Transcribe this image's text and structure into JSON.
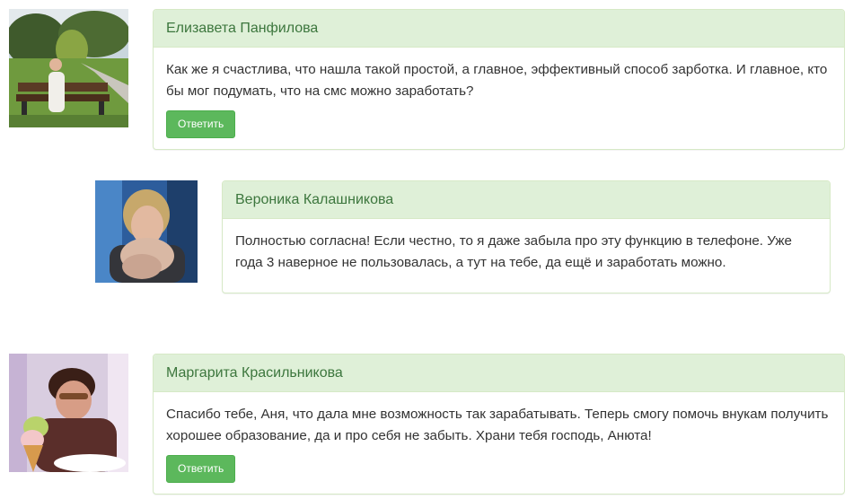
{
  "comments": [
    {
      "author": "Елизавета Панфилова",
      "text": "Как же я счастлива, что нашла такой простой, а главное, эффективный способ зарботка. И главное, кто бы мог подумать, что на смс можно заработать?",
      "reply_label": "Ответить"
    },
    {
      "author": "Вероника Калашникова",
      "text": "Полностью согласна! Если честно, то я даже забыла про эту функцию в телефоне. Уже года 3 наверное не пользовалась, а тут на тебе, да ещё и заработать можно."
    },
    {
      "author": "Маргарита Красильникова",
      "text": "Спасибо тебе, Аня, что дала мне возможность так зарабатывать. Теперь смогу помочь внукам получить хорошее образование, да и про себя не забыть. Храни тебя господь, Анюта!",
      "reply_label": "Ответить"
    }
  ],
  "colors": {
    "heading_bg": "#dff0d8",
    "heading_text": "#3c763d",
    "panel_border": "#d6e9c6",
    "button_bg": "#5cb85c"
  }
}
